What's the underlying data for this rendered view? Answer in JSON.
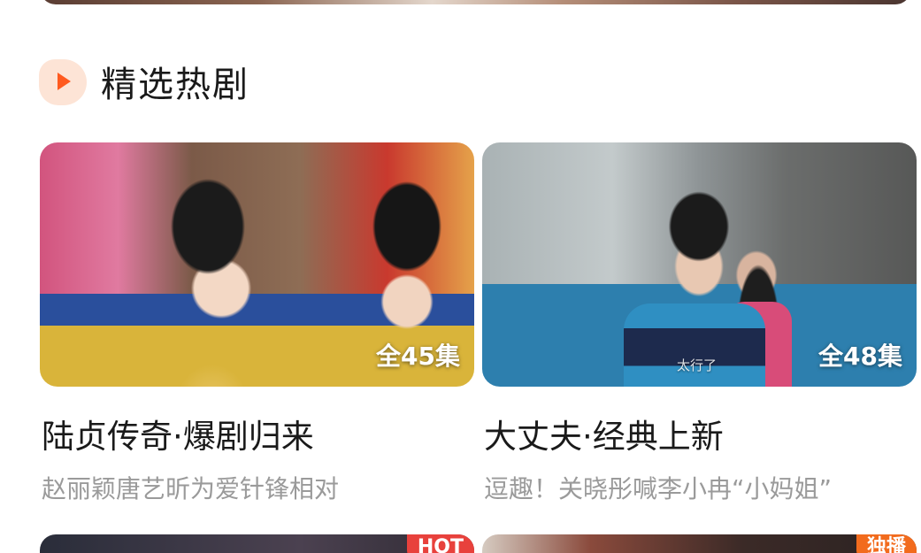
{
  "section": {
    "title": "精选热剧",
    "icon": "play-icon"
  },
  "cards": [
    {
      "episodes": "全45集",
      "title": "陆贞传奇·爆剧归来",
      "subtitle": "赵丽颖唐艺昕为爱针锋相对"
    },
    {
      "episodes": "全48集",
      "watermark": "太行了",
      "title": "大丈夫·经典上新",
      "subtitle": "逗趣！关晓彤喊李小冉“小妈姐”"
    }
  ],
  "next_row": [
    {
      "tag": "HOT"
    },
    {
      "tag": "独播"
    }
  ],
  "colors": {
    "accent": "#ff5a1f",
    "icon_bg": "#fde4d6",
    "subtitle": "#9a9a9a",
    "tag_hot": "#e8413c",
    "tag_exclusive": "#f26b1d"
  }
}
